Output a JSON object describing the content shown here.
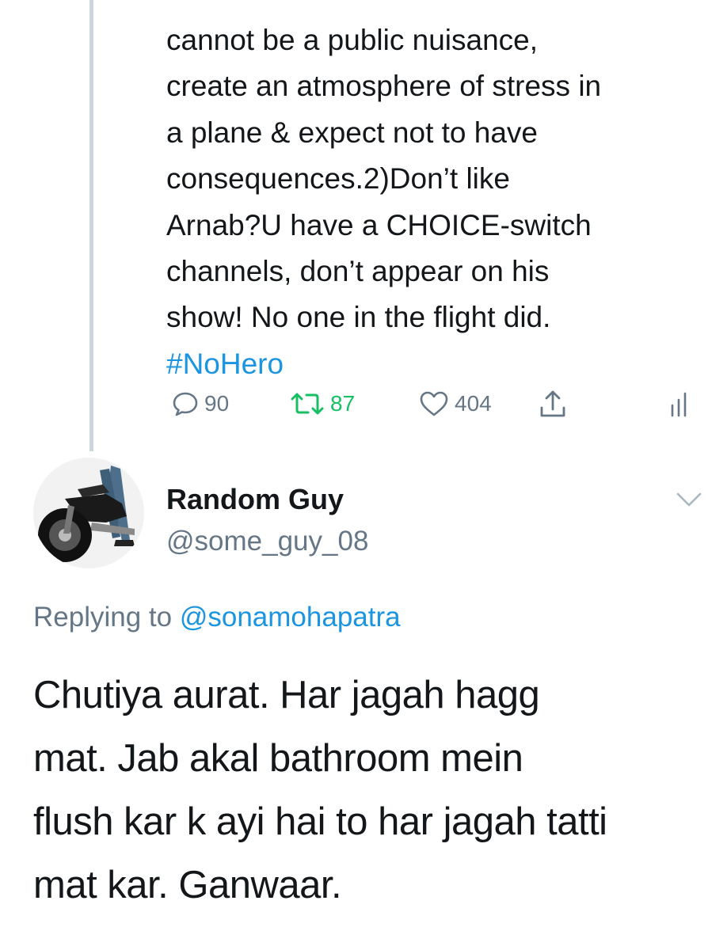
{
  "parent_tweet": {
    "text_lines": [
      "cannot be a public nuisance,",
      "create an atmosphere of stress in",
      "a plane & expect not to have",
      "consequences.2)Don’t like",
      "Arnab?U have a CHOICE-switch",
      "channels, don’t appear on his",
      "show! No one in the flight did."
    ],
    "hashtag": "#NoHero",
    "actions": {
      "reply_count": "90",
      "retweet_count": "87",
      "like_count": "404",
      "reply_icon": "reply-bubble-icon",
      "retweet_icon": "retweet-icon",
      "like_icon": "heart-icon",
      "share_icon": "share-icon",
      "analytics_icon": "analytics-icon"
    }
  },
  "reply_tweet": {
    "author": {
      "name": "Random Guy",
      "handle": "@some_guy_08",
      "avatar_icon": "motorcycle-avatar"
    },
    "menu_icon": "chevron-down-icon",
    "replying_to": {
      "prefix": "Replying to",
      "mention": "@sonamohapatra"
    },
    "text_lines": [
      "Chutiya aurat. Har jagah hagg",
      "mat. Jab akal bathroom mein",
      "flush kar k ayi hai to har jagah tatti",
      "mat kar. Ganwaar."
    ]
  },
  "colors": {
    "text": "#14171a",
    "secondary": "#657786",
    "link": "#1b95e0",
    "retweet_active": "#17bf63",
    "thread_line": "#ccd6dd"
  }
}
